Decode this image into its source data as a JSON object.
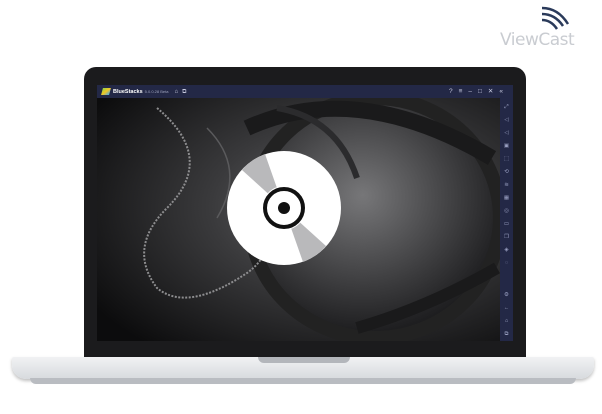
{
  "watermark": {
    "text": "ViewCast"
  },
  "window": {
    "app_name": "BlueStacks",
    "version": "5.0.0.28 Beta",
    "title_icons": [
      "home-icon",
      "multi-instance-icon"
    ],
    "controls": [
      "help-icon",
      "menu-icon",
      "minimize-icon",
      "maximize-icon",
      "close-icon",
      "collapse-icon"
    ]
  },
  "sidebar": {
    "icons_top": [
      "fullscreen-icon",
      "volume-up-icon",
      "volume-down-icon",
      "keyboard-icon",
      "gamepad-icon",
      "rotate-icon",
      "shake-icon",
      "screenshot-icon",
      "record-icon",
      "folder-icon",
      "copy-icon",
      "layers-icon",
      "eco-icon"
    ],
    "icons_bottom": [
      "settings-icon",
      "back-icon",
      "home-icon",
      "recents-icon"
    ]
  },
  "colors": {
    "titlebar": "#232846",
    "disc": "#ffffff",
    "background": "#141416"
  }
}
